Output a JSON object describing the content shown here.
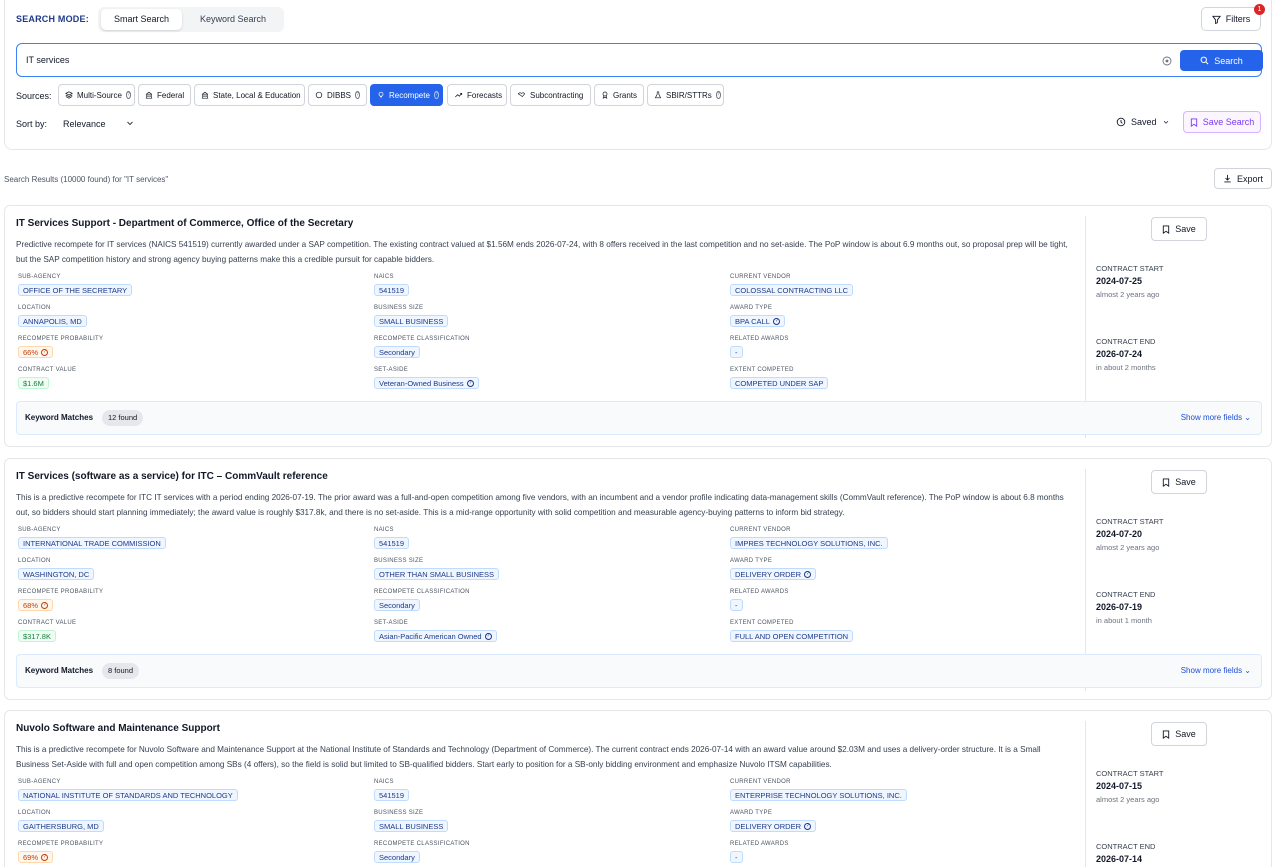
{
  "search_mode": {
    "label": "SEARCH MODE:",
    "tabs": [
      "Smart Search",
      "Keyword Search"
    ],
    "active": 0
  },
  "filters": {
    "label": "Filters",
    "badge": "1"
  },
  "search": {
    "value": "IT services",
    "button": "Search"
  },
  "sources": {
    "label": "Sources:",
    "chips": [
      {
        "label": "Multi-Source",
        "icon": "layers-icon",
        "info": true,
        "active": false
      },
      {
        "label": "Federal",
        "icon": "building-icon",
        "info": false,
        "active": false
      },
      {
        "label": "State, Local & Education",
        "icon": "building-icon",
        "info": false,
        "active": false
      },
      {
        "label": "DIBBS",
        "icon": "circle-icon",
        "info": true,
        "active": false
      },
      {
        "label": "Recompete",
        "icon": "bulb-icon",
        "info": true,
        "active": true
      },
      {
        "label": "Forecasts",
        "icon": "trend-icon",
        "info": false,
        "active": false
      },
      {
        "label": "Subcontracting",
        "icon": "handshake-icon",
        "info": false,
        "active": false
      },
      {
        "label": "Grants",
        "icon": "award-icon",
        "info": false,
        "active": false
      },
      {
        "label": "SBIR/STTRs",
        "icon": "flask-icon",
        "info": true,
        "active": false
      }
    ]
  },
  "sort": {
    "label": "Sort by:",
    "value": "Relevance"
  },
  "saved": {
    "label": "Saved"
  },
  "save_search": {
    "label": "Save Search"
  },
  "results_summary": "Search Results (10000 found) for \"IT services\"",
  "export": {
    "label": "Export"
  },
  "labels": {
    "sub_agency": "SUB-AGENCY",
    "naics": "NAICS",
    "current_vendor": "CURRENT VENDOR",
    "location": "LOCATION",
    "business_size": "BUSINESS SIZE",
    "award_type": "AWARD TYPE",
    "recompete_probability": "RECOMPETE PROBABILITY",
    "recompete_classification": "RECOMPETE CLASSIFICATION",
    "related_awards": "RELATED AWARDS",
    "contract_value": "CONTRACT VALUE",
    "set_aside": "SET-ASIDE",
    "extent_competed": "EXTENT COMPETED",
    "contract_start": "CONTRACT START",
    "contract_end": "CONTRACT END",
    "keyword_matches": "Keyword Matches",
    "show_more": "Show more fields",
    "save": "Save"
  },
  "results": [
    {
      "title": "IT Services Support - Department of Commerce, Office of the Secretary",
      "description": "Predictive recompete for IT services (NAICS 541519) currently awarded under a SAP competition. The existing contract valued at $1.56M ends 2026-07-24, with 8 offers received in the last competition and no set-aside. The PoP window is about 6.9 months out, so proposal prep will be tight, but the SAP competition history and strong agency buying patterns make this a credible pursuit for capable bidders.",
      "sub_agency": "OFFICE OF THE SECRETARY",
      "naics": "541519",
      "current_vendor": "COLOSSAL CONTRACTING LLC",
      "location": "ANNAPOLIS, MD",
      "business_size": "SMALL BUSINESS",
      "award_type": "BPA CALL",
      "recompete_probability": "66%",
      "recompete_classification": "Secondary",
      "related_awards": "-",
      "contract_value": "$1.6M",
      "set_aside": "Veteran-Owned Business",
      "set_aside_info": true,
      "extent_competed": "COMPETED UNDER SAP",
      "contract_start": "2024-07-25",
      "contract_start_rel": "almost 2 years ago",
      "contract_end": "2026-07-24",
      "contract_end_rel": "in about 2 months",
      "keyword_count": "12 found"
    },
    {
      "title": "IT Services (software as a service) for ITC – CommVault reference",
      "description": "This is a predictive recompete for ITC IT services with a period ending 2026-07-19. The prior award was a full-and-open competition among five vendors, with an incumbent and a vendor profile indicating data-management skills (CommVault reference). The PoP window is about 6.8 months out, so bidders should start planning immediately; the award value is roughly $317.8k, and there is no set-aside. This is a mid-range opportunity with solid competition and measurable agency-buying patterns to inform bid strategy.",
      "sub_agency": "INTERNATIONAL TRADE COMMISSION",
      "naics": "541519",
      "current_vendor": "IMPRES TECHNOLOGY SOLUTIONS, INC.",
      "location": "WASHINGTON, DC",
      "business_size": "OTHER THAN SMALL BUSINESS",
      "award_type": "DELIVERY ORDER",
      "recompete_probability": "68%",
      "recompete_classification": "Secondary",
      "related_awards": "-",
      "contract_value": "$317.8K",
      "set_aside": "Asian-Pacific American Owned",
      "set_aside_info": true,
      "extent_competed": "FULL AND OPEN COMPETITION",
      "contract_start": "2024-07-20",
      "contract_start_rel": "almost 2 years ago",
      "contract_end": "2026-07-19",
      "contract_end_rel": "in about 1 month",
      "keyword_count": "8 found"
    },
    {
      "title": "Nuvolo Software and Maintenance Support",
      "description": "This is a predictive recompete for Nuvolo Software and Maintenance Support at the National Institute of Standards and Technology (Department of Commerce). The current contract ends 2026-07-14 with an award value around $2.03M and uses a delivery-order structure. It is a Small Business Set-Aside with full and open competition among SBs (4 offers), so the field is solid but limited to SB-qualified bidders. Start early to position for a SB-only bidding environment and emphasize Nuvolo ITSM capabilities.",
      "sub_agency": "NATIONAL INSTITUTE OF STANDARDS AND TECHNOLOGY",
      "naics": "541519",
      "current_vendor": "ENTERPRISE TECHNOLOGY SOLUTIONS, INC.",
      "location": "GAITHERSBURG, MD",
      "business_size": "SMALL BUSINESS",
      "award_type": "DELIVERY ORDER",
      "recompete_probability": "69%",
      "recompete_classification": "Secondary",
      "related_awards": "-",
      "contract_start": "2024-07-15",
      "contract_start_rel": "almost 2 years ago",
      "contract_end": "2026-07-14"
    }
  ]
}
